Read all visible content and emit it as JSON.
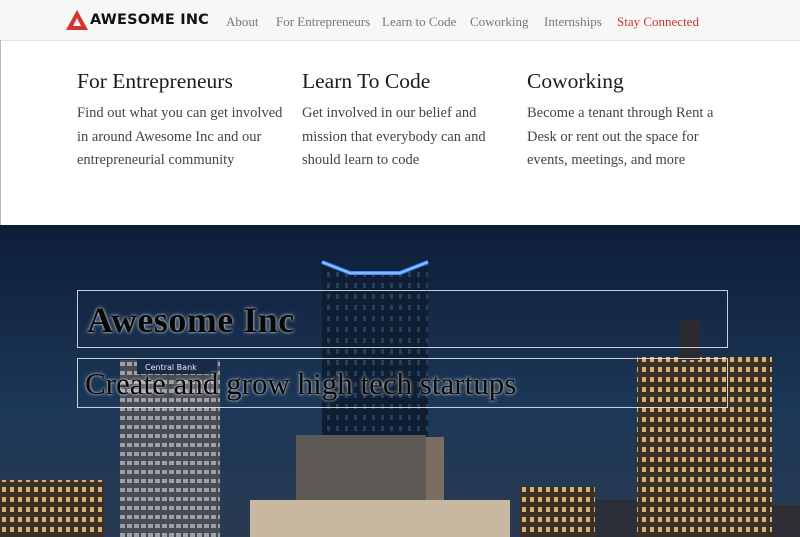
{
  "brand": {
    "name": "AWESOME INC",
    "logo_color": "#d0342c"
  },
  "nav": {
    "items": [
      {
        "label": "About"
      },
      {
        "label": "For Entrepreneurs"
      },
      {
        "label": "Learn to Code"
      },
      {
        "label": "Coworking"
      },
      {
        "label": "Internships"
      },
      {
        "label": "Stay Connected",
        "accent": true
      }
    ],
    "accent_color": "#c0392b"
  },
  "features": [
    {
      "title": "For Entrepreneurs",
      "text": "Find out what you can get involved in around Awesome Inc and our entrepreneurial community"
    },
    {
      "title": "Learn To Code",
      "text": "Get involved in our belief and mission that everybody can and should learn to code"
    },
    {
      "title": "Coworking",
      "text": "Become a tenant through Rent a Desk or rent out the space for events, meetings, and more"
    }
  ],
  "hero": {
    "title": "Awesome Inc",
    "subtitle": "Create and grow high tech startups",
    "sign_text": "Central Bank"
  }
}
